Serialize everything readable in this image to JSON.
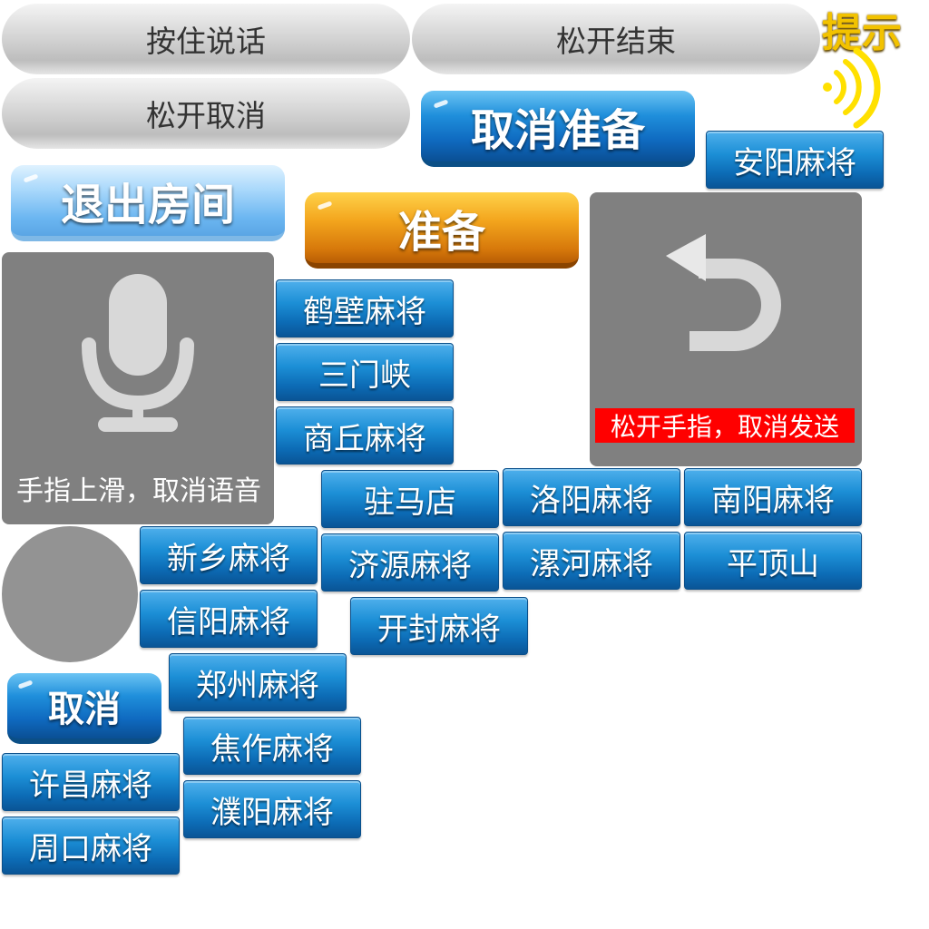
{
  "voice": {
    "hold_to_talk": "按住说话",
    "release_to_end": "松开结束",
    "release_to_cancel": "松开取消",
    "swipe_up_to_cancel": "手指上滑，取消语音",
    "release_finger_cancel_send": "松开手指，取消发送"
  },
  "buttons": {
    "cancel_ready": "取消准备",
    "exit_room": "退出房间",
    "ready": "准备",
    "cancel": "取消"
  },
  "hint": "提示",
  "regions": {
    "anyang": "安阳麻将",
    "hebi": "鹤壁麻将",
    "sanmenxia": "三门峡",
    "shangqiu": "商丘麻将",
    "zhumadian": "驻马店",
    "luoyang": "洛阳麻将",
    "nanyang": "南阳麻将",
    "xinxiang": "新乡麻将",
    "jiyuan": "济源麻将",
    "luohe": "漯河麻将",
    "pingdingshan": "平顶山",
    "xinyang": "信阳麻将",
    "kaifeng": "开封麻将",
    "zhengzhou": "郑州麻将",
    "jiaozuo": "焦作麻将",
    "xuchang": "许昌麻将",
    "puyang": "濮阳麻将",
    "zhoukou": "周口麻将"
  },
  "icons": {
    "microphone": "microphone-icon",
    "undo": "undo-arrow-icon",
    "signal": "sound-wave-icon"
  },
  "colors": {
    "region_button": "#1c8fd6",
    "warning": "#ff0000",
    "panel": "#808080",
    "hint": "#f2c200"
  }
}
